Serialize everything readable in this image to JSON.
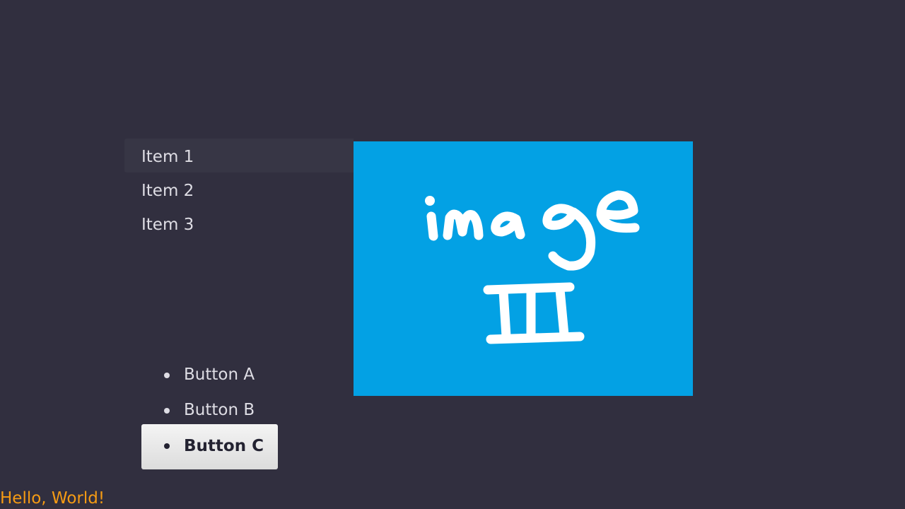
{
  "menu": {
    "items": [
      {
        "label": "Item 1",
        "selected": true
      },
      {
        "label": "Item 2",
        "selected": false
      },
      {
        "label": "Item 3",
        "selected": false
      }
    ]
  },
  "image_panel": {
    "caption": "image",
    "numeral": "III",
    "background_color": "#03a1e4"
  },
  "buttons": {
    "items": [
      {
        "label": "Button A",
        "focused": false
      },
      {
        "label": "Button B",
        "focused": false
      },
      {
        "label": "Button C",
        "focused": true
      }
    ]
  },
  "footer": {
    "text": "Hello, World!",
    "color": "#f59b14"
  },
  "colors": {
    "background": "#312f3f",
    "text": "#dedde4",
    "selected_row": "#373645"
  }
}
